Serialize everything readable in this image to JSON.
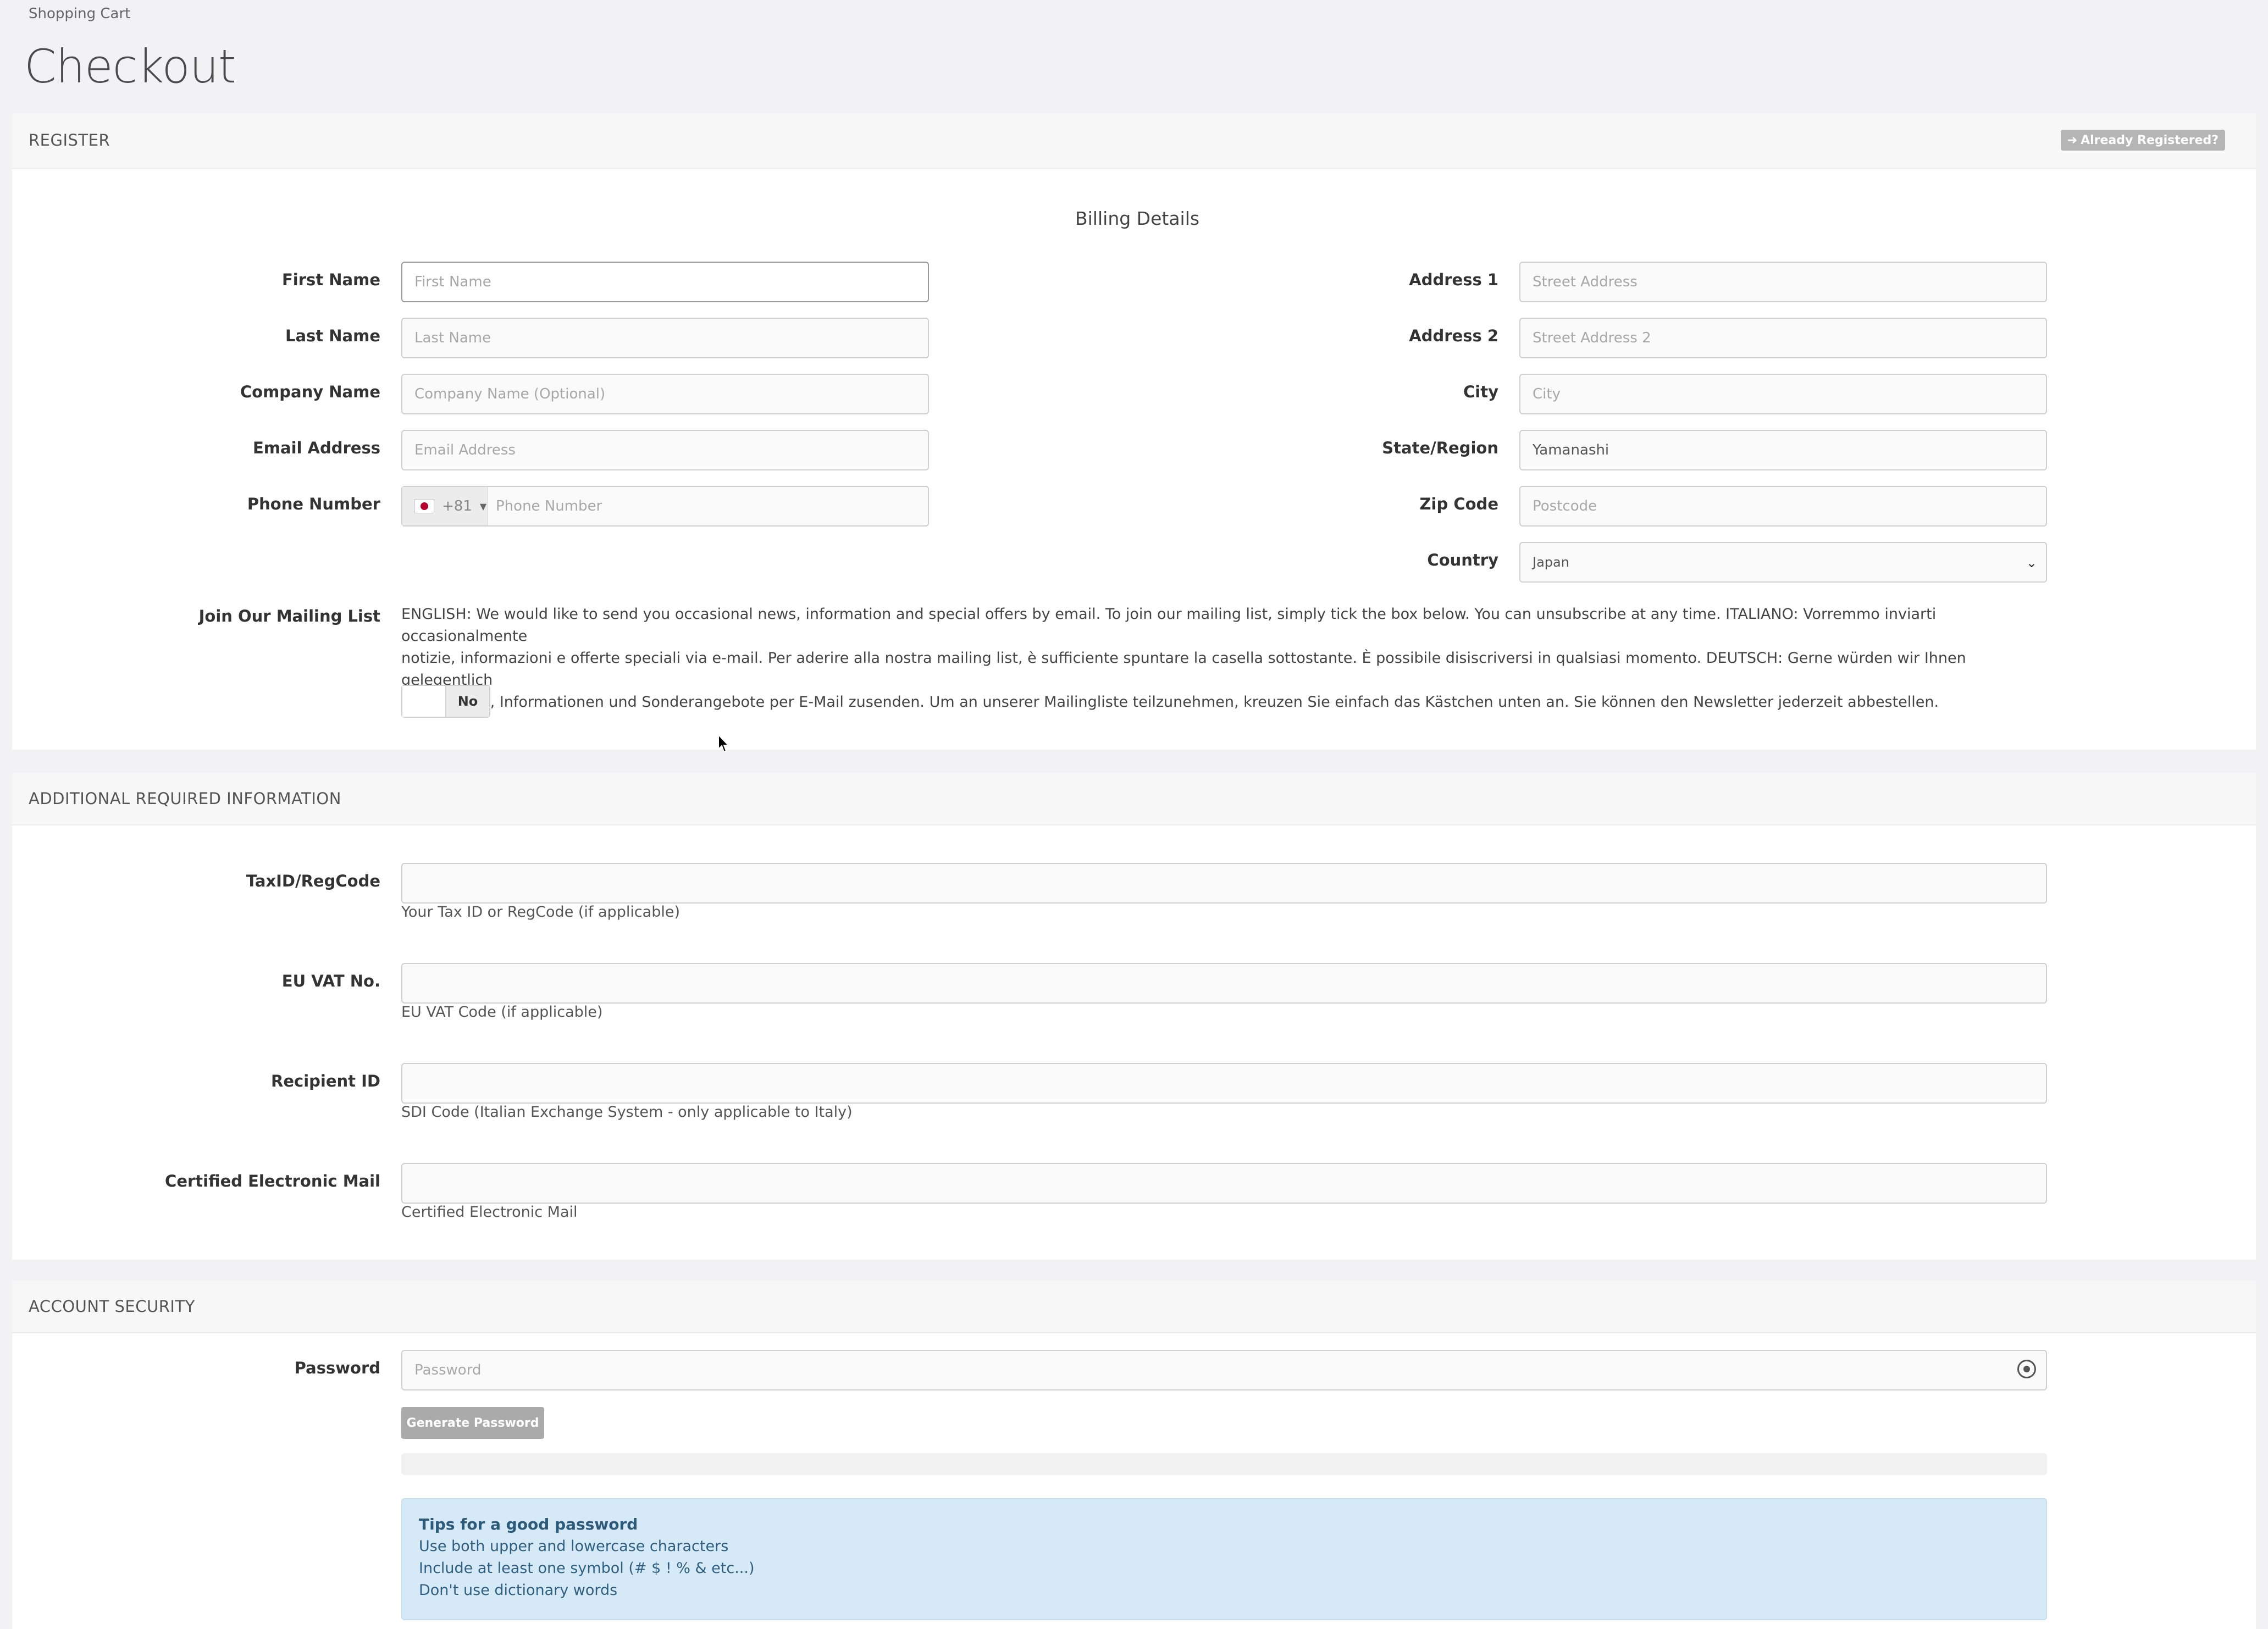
{
  "breadcrumb": "Shopping Cart",
  "page_title": "Checkout",
  "register": {
    "header": "REGISTER",
    "already_registered": "Already Registered?",
    "billing_title": "Billing Details",
    "first_name": {
      "label": "First Name",
      "placeholder": "First Name"
    },
    "last_name": {
      "label": "Last Name",
      "placeholder": "Last Name"
    },
    "company": {
      "label": "Company Name",
      "placeholder": "Company Name (Optional)"
    },
    "email": {
      "label": "Email Address",
      "placeholder": "Email Address"
    },
    "phone": {
      "label": "Phone Number",
      "dial_code": "+81",
      "placeholder": "Phone Number"
    },
    "address1": {
      "label": "Address 1",
      "placeholder": "Street Address"
    },
    "address2": {
      "label": "Address 2",
      "placeholder": "Street Address 2"
    },
    "city": {
      "label": "City",
      "placeholder": "City"
    },
    "state": {
      "label": "State/Region",
      "value": "Yamanashi"
    },
    "zip": {
      "label": "Zip Code",
      "placeholder": "Postcode"
    },
    "country": {
      "label": "Country",
      "value": "Japan"
    },
    "mailing": {
      "label": "Join Our Mailing List",
      "text_line1": "ENGLISH: We would like to send you occasional news, information and special offers by email. To join our mailing list, simply tick the box below. You can unsubscribe at any time. ITALIANO: Vorremmo inviarti occasionalmente",
      "text_line2": "notizie, informazioni e offerte speciali via e-mail. Per aderire alla nostra mailing list, è sufficiente spuntare la casella sottostante. È possibile disiscriversi in qualsiasi momento. DEUTSCH: Gerne würden wir Ihnen gelegentlich",
      "text_line3": "Neuigkeiten, Informationen und Sonderangebote per E-Mail zusenden. Um an unserer Mailingliste teilzunehmen, kreuzen Sie einfach das Kästchen unten an. Sie können den Newsletter jederzeit abbestellen.",
      "toggle_label": "No"
    }
  },
  "additional": {
    "header": "ADDITIONAL REQUIRED INFORMATION",
    "taxid": {
      "label": "TaxID/RegCode",
      "help": "Your Tax ID or RegCode (if applicable)"
    },
    "euvat": {
      "label": "EU VAT No.",
      "help": "EU VAT Code (if applicable)"
    },
    "recipient": {
      "label": "Recipient ID",
      "help": "SDI Code (Italian Exchange System - only applicable to Italy)"
    },
    "pec": {
      "label": "Certified Electronic Mail",
      "help": "Certified Electronic Mail"
    }
  },
  "security": {
    "header": "ACCOUNT SECURITY",
    "password": {
      "label": "Password",
      "placeholder": "Password"
    },
    "generate_label": "Generate Password",
    "tips": {
      "title": "Tips for a good password",
      "line1": "Use both upper and lowercase characters",
      "line2": "Include at least one symbol (# $ ! % & etc...)",
      "line3": "Don't use dictionary words"
    }
  },
  "icons": {
    "eye": "eye-icon",
    "login": "sign-in-icon",
    "cursor": "mouse-cursor-icon"
  }
}
